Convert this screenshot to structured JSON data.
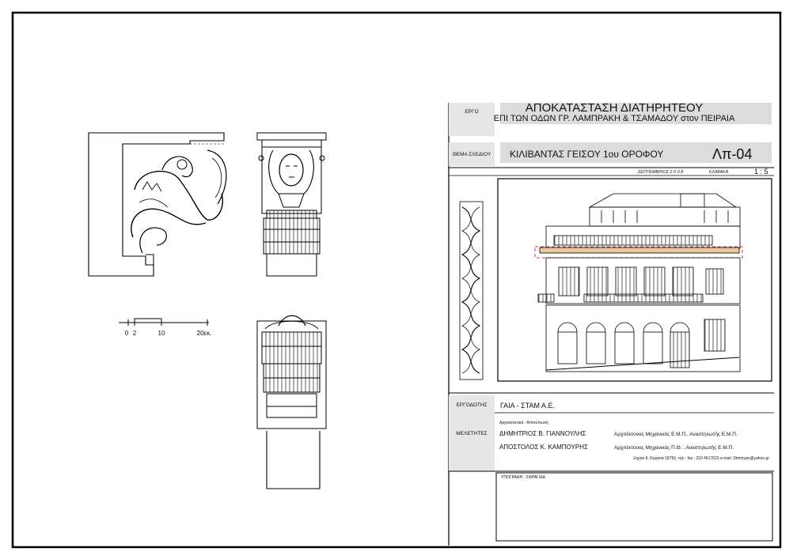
{
  "title_block": {
    "project_label": "ΕΡΓΟ",
    "project_title_line1": "ΑΠΟΚΑΤΑΣΤΑΣΗ  ΔΙΑΤΗΡΗΤΕΟΥ",
    "project_title_line2": "ΕΠΙ ΤΩΝ ΟΔΩΝ  ΓΡ. ΛΑΜΠΡΑΚΗ & ΤΣΑΜΑΔΟΥ στον ΠΕΙΡΑΙΑ",
    "subject_label": "ΘΕΜΑ ΣΧΕΔΙΟΥ",
    "subject": "ΚΙΛΙΒΑΝΤΑΣ ΓΕΙΣΟΥ 1ου ΟΡΟΦΟΥ",
    "drawing_code": "Λπ-04",
    "date": "ΣΕΠΤΕΜΒΡΙΟΣ  2 0 0 8",
    "scale_label": "ΚΛΙΜΑΚΑ",
    "scale": "1 : 5",
    "client_label": "ΕΡΓΟΔΟΤΗΣ",
    "client": "ΓΑΙΑ  -  ΣΤΑΜ  Α.Ε.",
    "designers_label": "ΜΕΛΕΤΗΤΕΣ",
    "designers_caption": "Αρχιτεκτονικά - Αποτύπωση",
    "designer1_name": "ΔΗΜΗΤΡΙΟΣ Β. ΓΙΑΝΝΟΥΛΗΣ",
    "designer1_role": "Αρχιτέκτονας Μηχανικός Ε.Μ.Π., Αναστηλωτής Ε.Μ.Π.",
    "designer2_name": "ΑΠΟΣΤΟΛΟΣ Κ. ΚΑΜΠΟΥΡΗΣ",
    "designer2_role": "Αρχιτέκτονας Μηχανικός Π.Θ. ,  Αναστηλωτής Ε.Μ.Π.",
    "contact": "Ξηρού 8, Κηφισιά 18756, τηλ - fax : 210  4617623  e-mail: Dimmyan@yahoo.gr",
    "signature_label": "ΥΠΟΓΡΑΦΗ - ΣΦΡΑΓΙΔΑ"
  },
  "scale_bar": {
    "labels": [
      "0",
      "2",
      "10",
      "20εκ."
    ]
  }
}
